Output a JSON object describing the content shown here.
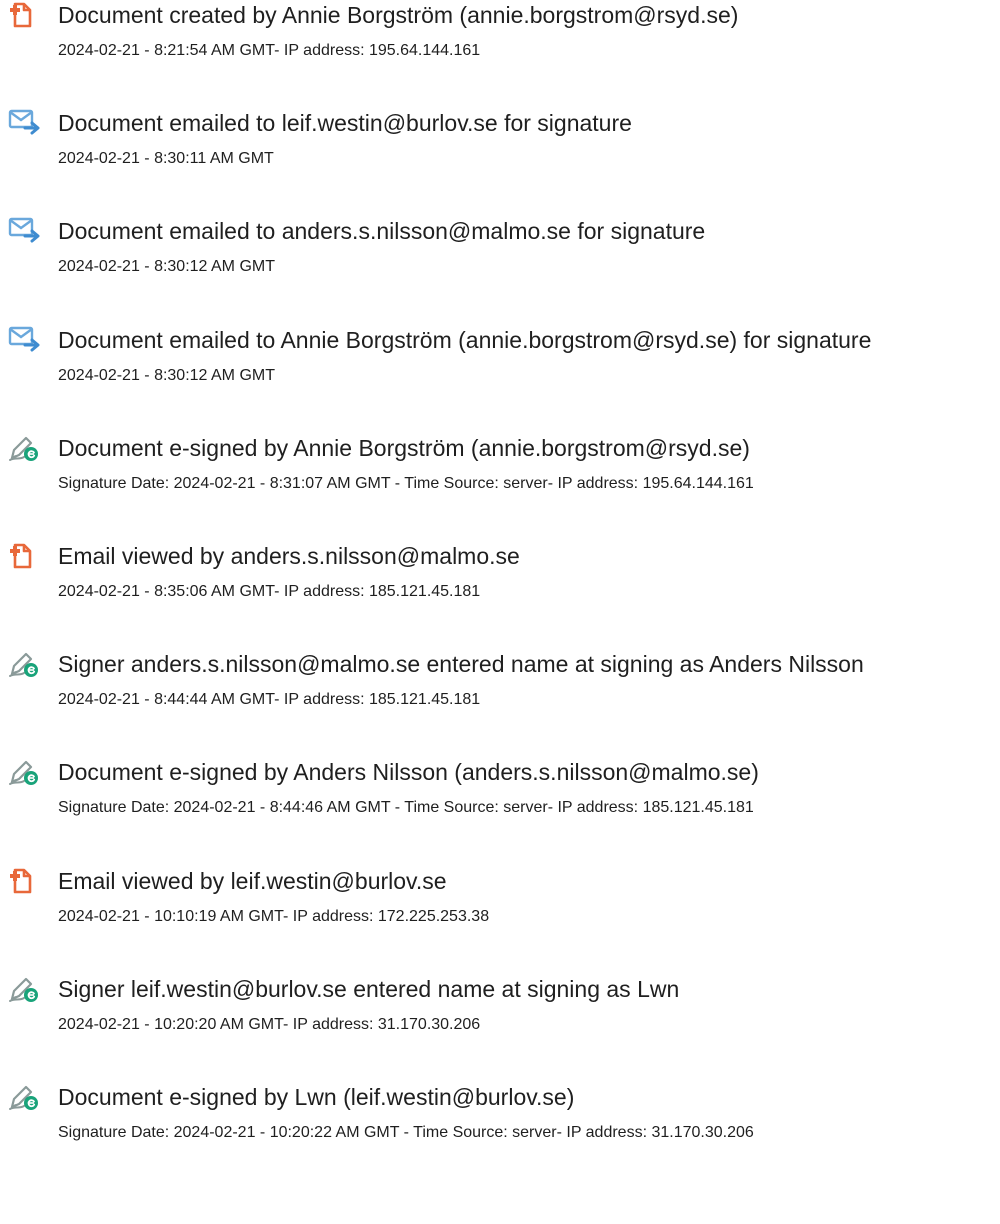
{
  "audit_trail": {
    "events": [
      {
        "type": "created",
        "icon": "document-created-icon",
        "title": "Document created by Annie Borgström (annie.borgstrom@rsyd.se)",
        "detail": "2024-02-21 - 8:21:54 AM GMT- IP address: 195.64.144.161"
      },
      {
        "type": "emailed",
        "icon": "document-emailed-icon",
        "title": "Document emailed to leif.westin@burlov.se for signature",
        "detail": "2024-02-21 - 8:30:11 AM GMT"
      },
      {
        "type": "emailed",
        "icon": "document-emailed-icon",
        "title": "Document emailed to anders.s.nilsson@malmo.se for signature",
        "detail": "2024-02-21 - 8:30:12 AM GMT"
      },
      {
        "type": "emailed",
        "icon": "document-emailed-icon",
        "title": "Document emailed to Annie Borgström (annie.borgstrom@rsyd.se) for signature",
        "detail": "2024-02-21 - 8:30:12 AM GMT"
      },
      {
        "type": "signed",
        "icon": "e-sign-pen-icon",
        "title": "Document e-signed by Annie Borgström (annie.borgstrom@rsyd.se)",
        "detail": "Signature Date: 2024-02-21 - 8:31:07 AM GMT - Time Source: server- IP address: 195.64.144.161"
      },
      {
        "type": "viewed",
        "icon": "email-viewed-icon",
        "title": "Email viewed by anders.s.nilsson@malmo.se",
        "detail": "2024-02-21 - 8:35:06 AM GMT- IP address: 185.121.45.181"
      },
      {
        "type": "signed",
        "icon": "e-sign-pen-icon",
        "title": "Signer anders.s.nilsson@malmo.se entered name at signing as Anders Nilsson",
        "detail": "2024-02-21 - 8:44:44 AM GMT- IP address: 185.121.45.181"
      },
      {
        "type": "signed",
        "icon": "e-sign-pen-icon",
        "title": "Document e-signed by Anders Nilsson (anders.s.nilsson@malmo.se)",
        "detail": "Signature Date: 2024-02-21 - 8:44:46 AM GMT - Time Source: server- IP address: 185.121.45.181"
      },
      {
        "type": "viewed",
        "icon": "email-viewed-icon",
        "title": "Email viewed by leif.westin@burlov.se",
        "detail": "2024-02-21 - 10:10:19 AM GMT- IP address: 172.225.253.38"
      },
      {
        "type": "signed",
        "icon": "e-sign-pen-icon",
        "title": "Signer leif.westin@burlov.se entered name at signing as Lwn",
        "detail": "2024-02-21 - 10:20:20 AM GMT- IP address: 31.170.30.206"
      },
      {
        "type": "signed",
        "icon": "e-sign-pen-icon",
        "title": "Document e-signed by Lwn (leif.westin@burlov.se)",
        "detail": "Signature Date: 2024-02-21 - 10:20:22 AM GMT - Time Source: server- IP address: 31.170.30.206"
      }
    ]
  },
  "colors": {
    "created_icon": "#e8683a",
    "email_icon": "#4f9ad6",
    "sign_icon_pen": "#8a9a99",
    "sign_icon_badge": "#19a37a",
    "text": "#1f1f1f"
  }
}
